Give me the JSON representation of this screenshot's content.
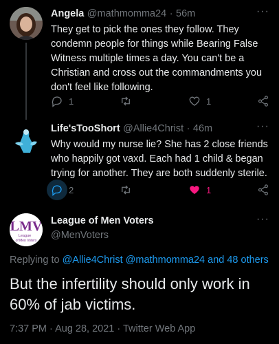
{
  "tweets": [
    {
      "name": "Angela",
      "handle": "@mathmomma24",
      "dot": "·",
      "time": "56m",
      "more": "···",
      "lines": [
        "They get to pick the ones they follow. They",
        "condemn people for things while Bearing False",
        "Witness multiple times a day. You can't be a",
        "Christian and cross out the commandments you",
        "don't feel like following."
      ],
      "reply_count": "1",
      "retweet_count": "",
      "like_count": "1"
    },
    {
      "name": "Life'sTooShort",
      "handle": "@Allie4Christ",
      "dot": "·",
      "time": "46m",
      "more": "···",
      "lines": [
        "Why would my nurse lie?  She has 2 close friends",
        "who happily got vaxd. Each had 1 child & began",
        "trying for another. They are both suddenly sterile."
      ],
      "reply_count": "2",
      "retweet_count": "",
      "like_count": "1"
    }
  ],
  "main_tweet": {
    "name": "League of Men Voters",
    "handle": "@MenVoters",
    "more": "···",
    "logo_text": "LMV",
    "logo_sub1": "League",
    "logo_sub2": "of Men Voters",
    "replying_prefix": "Replying to",
    "replying_to": "@Allie4Christ @mathmomma24 and 48 others",
    "lines": [
      "But the infertility should only work in",
      "60% of jab victims."
    ],
    "timestamp": "7:37 PM · Aug 28, 2021 · Twitter Web App"
  },
  "colors": {
    "accent": "#1d9bf0",
    "like": "#f91880",
    "muted": "#71767b"
  }
}
